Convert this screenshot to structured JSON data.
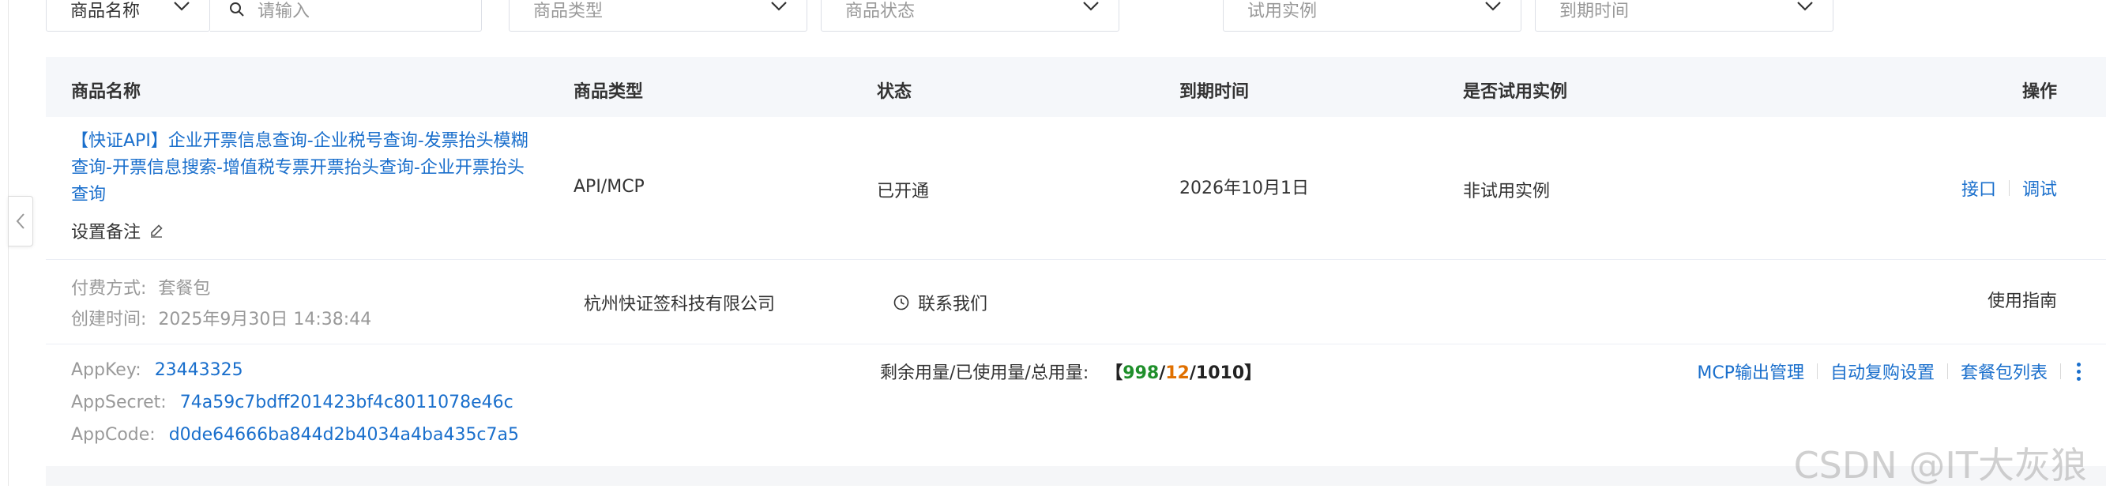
{
  "filters": {
    "name_select": "商品名称",
    "search_placeholder": "请输入",
    "type_select": "商品类型",
    "status_select": "商品状态",
    "trial_select": "试用实例",
    "expire_select": "到期时间"
  },
  "table": {
    "headers": {
      "name": "商品名称",
      "type": "商品类型",
      "status": "状态",
      "expire": "到期时间",
      "trial": "是否试用实例",
      "actions": "操作"
    },
    "row": {
      "title": "【快证API】企业开票信息查询-企业税号查询-发票抬头模糊查询-开票信息搜索-增值税专票开票抬头查询-企业开票抬头查询",
      "remark_label": "设置备注",
      "type": "API/MCP",
      "status": "已开通",
      "expire": "2026年10月1日",
      "trial": "非试用实例",
      "op_interface": "接口",
      "op_debug": "调试",
      "pay_label": "付费方式:",
      "pay_value": "套餐包",
      "created_label": "创建时间:",
      "created_value": "2025年9月30日 14:38:44",
      "provider": "杭州快证签科技有限公司",
      "contact": "联系我们",
      "guide": "使用指南",
      "appkey_label": "AppKey:",
      "appkey_value": "23443325",
      "appsecret_label": "AppSecret:",
      "appsecret_value": "74a59c7bdff201423bf4c8011078e46c",
      "appcode_label": "AppCode:",
      "appcode_value": "d0de64666ba844d2b4034a4ba435c7a5",
      "usage_label": "剩余用量/已使用量/总用量:",
      "usage_open": "【",
      "usage_remaining": "998",
      "usage_slash1": "/",
      "usage_used": "12",
      "usage_slash2": "/",
      "usage_total": "1010",
      "usage_close": "】",
      "op_mcp": "MCP输出管理",
      "op_autorenew": "自动复购设置",
      "op_packages": "套餐包列表"
    }
  },
  "watermark": "CSDN @IT大灰狼",
  "colors": {
    "link": "#1a6fcc",
    "header_bg": "#f5f7fa",
    "remaining": "#1f8f2b",
    "used": "#e07000"
  },
  "icons": [
    "chevron-down-icon",
    "search-icon",
    "edit-icon",
    "clock-icon",
    "more-vertical-icon",
    "chevron-left-icon"
  ]
}
